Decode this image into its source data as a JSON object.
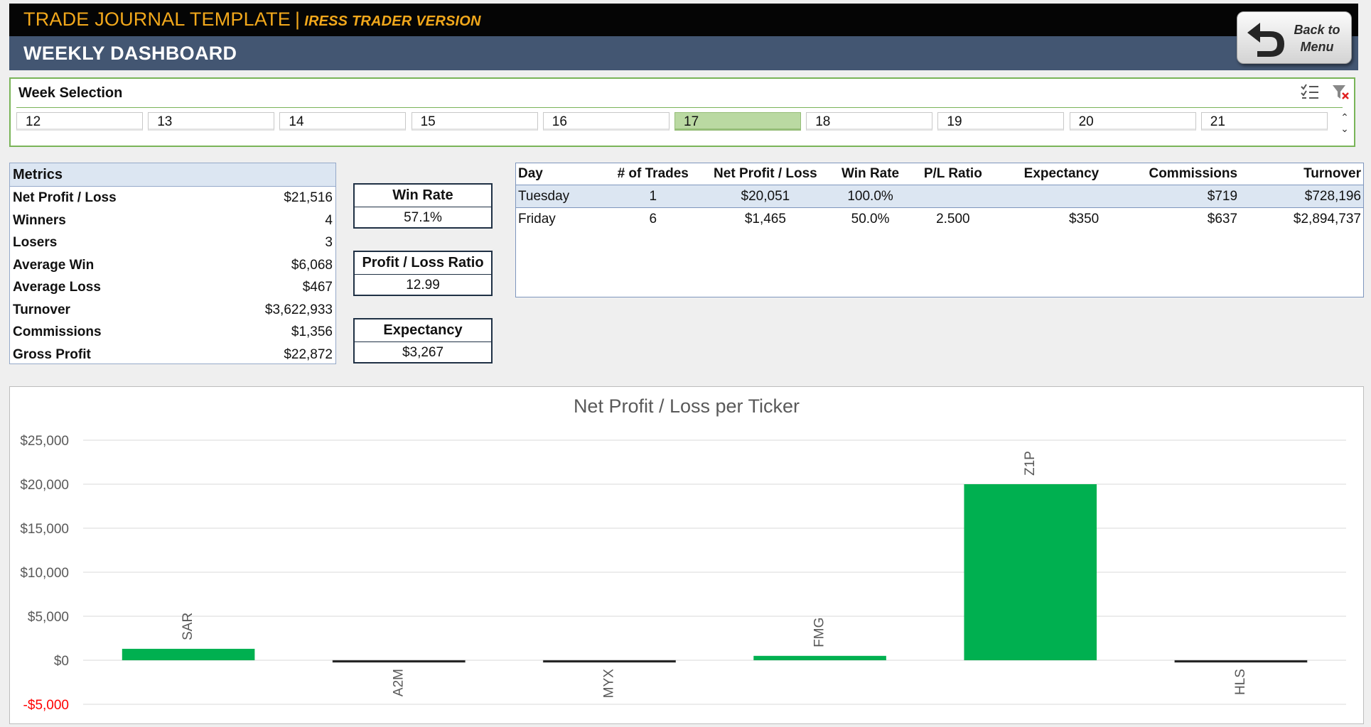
{
  "header": {
    "app_title": "TRADE JOURNAL TEMPLATE",
    "separator": "|",
    "version": "IRESS TRADER VERSION",
    "dashboard_title": "WEEKLY DASHBOARD",
    "back_button": {
      "line1": "Back to",
      "line2": "Menu"
    }
  },
  "slicer": {
    "title": "Week Selection",
    "selected": "17",
    "weeks": [
      "12",
      "13",
      "14",
      "15",
      "16",
      "17",
      "18",
      "19",
      "20",
      "21"
    ]
  },
  "metrics": {
    "header": "Metrics",
    "rows": [
      {
        "label": "Net Profit / Loss",
        "value": "$21,516"
      },
      {
        "label": "Winners",
        "value": "4"
      },
      {
        "label": "Losers",
        "value": "3"
      },
      {
        "label": "Average Win",
        "value": "$6,068"
      },
      {
        "label": "Average Loss",
        "value": "$467"
      },
      {
        "label": "Turnover",
        "value": "$3,622,933"
      },
      {
        "label": "Commissions",
        "value": "$1,356"
      },
      {
        "label": "Gross Profit",
        "value": "$22,872"
      }
    ]
  },
  "kpis": [
    {
      "title": "Win Rate",
      "value": "57.1%"
    },
    {
      "title": "Profit / Loss Ratio",
      "value": "12.99"
    },
    {
      "title": "Expectancy",
      "value": "$3,267"
    }
  ],
  "daily_table": {
    "columns": [
      "Day",
      "# of Trades",
      "Net Profit / Loss",
      "Win Rate",
      "P/L Ratio",
      "Expectancy",
      "Commissions",
      "Turnover"
    ],
    "rows": [
      [
        "Tuesday",
        "1",
        "$20,051",
        "100.0%",
        "",
        "",
        "$719",
        "$728,196"
      ],
      [
        "Friday",
        "6",
        "$1,465",
        "50.0%",
        "2.500",
        "$350",
        "$637",
        "$2,894,737"
      ]
    ]
  },
  "colors": {
    "positive_bar": "#00b050",
    "negative_bar": "#1a1a1a",
    "negative_axis_label": "#ff0000",
    "accent": "#f2a81b",
    "header_bg": "#435672"
  },
  "chart_data": {
    "type": "bar",
    "title": "Net Profit / Loss per Ticker",
    "categories": [
      "SAR",
      "A2M",
      "MYX",
      "FMG",
      "Z1P",
      "HLS"
    ],
    "values": [
      1300,
      -100,
      -100,
      500,
      20000,
      -150
    ],
    "ylim": [
      -5000,
      25000
    ],
    "yticks": [
      25000,
      20000,
      15000,
      10000,
      5000,
      0,
      -5000
    ],
    "ytick_labels": [
      "$25,000",
      "$20,000",
      "$15,000",
      "$10,000",
      "$5,000",
      "$0",
      "-$5,000"
    ],
    "grid": true,
    "legend": "none"
  }
}
